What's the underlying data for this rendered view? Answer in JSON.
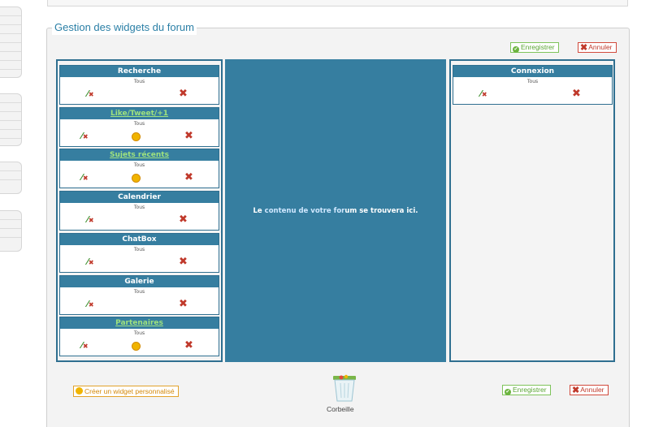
{
  "legend": "Gestion des widgets du forum",
  "buttons": {
    "save": "Enregistrer",
    "cancel": "Annuler",
    "create_widget": "Créer un widget personnalisé"
  },
  "center_text": {
    "part1": "Le ",
    "part2": "contenu de votre for",
    "part3": "um se trouvera ici."
  },
  "left_widgets": [
    {
      "title": "Recherche",
      "sub": "Tous",
      "link": false,
      "editable": false
    },
    {
      "title": "Like/Tweet/+1",
      "sub": "Tous",
      "link": true,
      "editable": true
    },
    {
      "title": "Sujets récents",
      "sub": "Tous",
      "link": true,
      "editable": true
    },
    {
      "title": "Calendrier",
      "sub": "Tous",
      "link": false,
      "editable": false
    },
    {
      "title": "ChatBox",
      "sub": "Tous",
      "link": false,
      "editable": false
    },
    {
      "title": "Galerie",
      "sub": "Tous",
      "link": false,
      "editable": false
    },
    {
      "title": "Partenaires",
      "sub": "Tous",
      "link": true,
      "editable": true
    }
  ],
  "right_widgets": [
    {
      "title": "Connexion",
      "sub": "Tous",
      "link": false,
      "editable": false
    }
  ],
  "trash_label": "Corbeille",
  "colors": {
    "accent": "#367ea0",
    "title": "#2a7fa6",
    "save": "#5aa534",
    "cancel": "#c0392b",
    "link": "#9fe27e"
  }
}
